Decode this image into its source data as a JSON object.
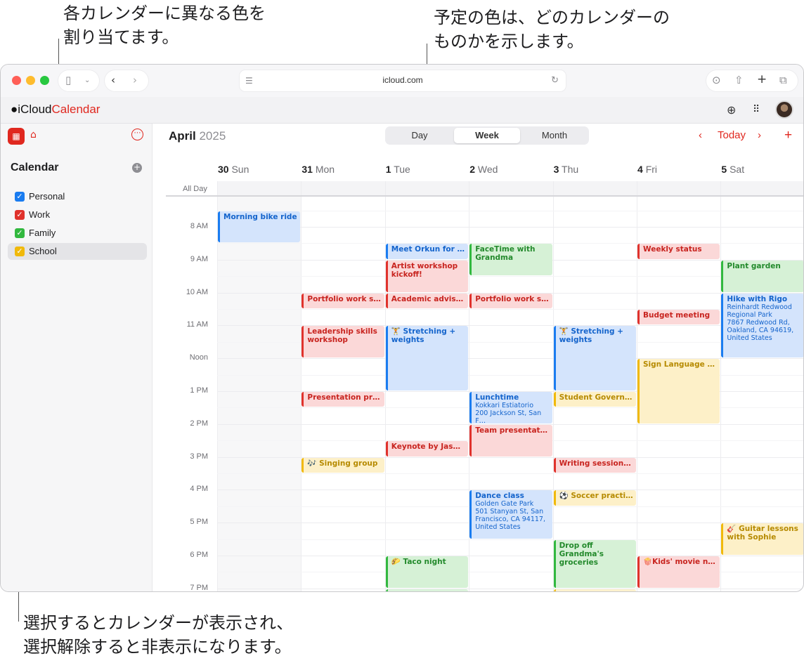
{
  "callouts": {
    "top_left": [
      "各カレンダーに異なる色を",
      "割り当てます。"
    ],
    "top_right": [
      "予定の色は、どのカレンダーの",
      "ものかを示します。"
    ],
    "bottom": [
      "選択するとカレンダーが表示され、",
      "選択解除すると非表示になります。"
    ]
  },
  "browser": {
    "url": "icloud.com",
    "traffic_lights": [
      "#ff5f57",
      "#febc2e",
      "#28c840"
    ]
  },
  "app": {
    "brand_prefix": "iCloud",
    "brand_name": "Calendar",
    "accent_color": "#e0281f"
  },
  "sidebar": {
    "section_title": "Calendar",
    "calendars": [
      {
        "label": "Personal",
        "color": "#1a7cf0",
        "checked": true,
        "selected": false
      },
      {
        "label": "Work",
        "color": "#e0322c",
        "checked": true,
        "selected": false
      },
      {
        "label": "Family",
        "color": "#32b83f",
        "checked": true,
        "selected": false
      },
      {
        "label": "School",
        "color": "#f0b90b",
        "checked": true,
        "selected": true
      }
    ]
  },
  "header": {
    "month": "April",
    "year": "2025",
    "views": [
      "Day",
      "Week",
      "Month"
    ],
    "active_view": "Week",
    "today_label": "Today"
  },
  "days": [
    {
      "num": "30",
      "name": "Sun"
    },
    {
      "num": "31",
      "name": "Mon"
    },
    {
      "num": "1",
      "name": "Tue"
    },
    {
      "num": "2",
      "name": "Wed"
    },
    {
      "num": "3",
      "name": "Thu"
    },
    {
      "num": "4",
      "name": "Fri"
    },
    {
      "num": "5",
      "name": "Sat"
    }
  ],
  "all_day_label": "All Day",
  "times": [
    "8 AM",
    "9 AM",
    "10 AM",
    "11 AM",
    "Noon",
    "1 PM",
    "2 PM",
    "3 PM",
    "4 PM",
    "5 PM",
    "6 PM",
    "7 PM"
  ],
  "events": [
    {
      "day": 0,
      "start": 7.5,
      "end": 8.5,
      "color": "blue",
      "title": "Morning bike ride",
      "trunc": false
    },
    {
      "day": 2,
      "start": 8.5,
      "end": 9.0,
      "color": "blue",
      "title": "Meet Orkun for coffee",
      "trunc": true
    },
    {
      "day": 2,
      "start": 9.0,
      "end": 10.0,
      "color": "red",
      "title": "Artist workshop kickoff!",
      "trunc": false
    },
    {
      "day": 2,
      "start": 10.0,
      "end": 10.5,
      "color": "red",
      "title": "Academic advising",
      "trunc": true
    },
    {
      "day": 2,
      "start": 11.0,
      "end": 13.0,
      "color": "blue",
      "title": "🏋 Stretching + weights",
      "trunc": false
    },
    {
      "day": 2,
      "start": 14.5,
      "end": 15.0,
      "color": "red",
      "title": "Keynote by Jasmine",
      "trunc": true
    },
    {
      "day": 2,
      "start": 18.0,
      "end": 19.0,
      "color": "green",
      "title": "🌮 Taco night",
      "trunc": true
    },
    {
      "day": 3,
      "start": 8.5,
      "end": 9.5,
      "color": "green",
      "title": "FaceTime with Grandma",
      "trunc": false
    },
    {
      "day": 3,
      "start": 10.0,
      "end": 10.5,
      "color": "red",
      "title": "Portfolio work session",
      "trunc": true
    },
    {
      "day": 3,
      "start": 13.0,
      "end": 14.0,
      "color": "blue",
      "title": "Lunchtime",
      "trunc": true,
      "sub": [
        "Kokkari Estiatorio",
        "200 Jackson St, San F…"
      ]
    },
    {
      "day": 3,
      "start": 14.0,
      "end": 15.0,
      "color": "red",
      "title": "Team presentation",
      "trunc": true
    },
    {
      "day": 3,
      "start": 16.0,
      "end": 17.5,
      "color": "blue",
      "title": "Dance class",
      "trunc": true,
      "sub": [
        "Golden Gate Park",
        "501 Stanyan St, San Francisco, CA 94117, United States"
      ]
    },
    {
      "day": 1,
      "start": 10.0,
      "end": 10.5,
      "color": "red",
      "title": "Portfolio work session",
      "trunc": true
    },
    {
      "day": 1,
      "start": 11.0,
      "end": 12.0,
      "color": "red",
      "title": "Leadership skills workshop",
      "trunc": false
    },
    {
      "day": 1,
      "start": 13.0,
      "end": 13.5,
      "color": "red",
      "title": "Presentation prep",
      "trunc": true
    },
    {
      "day": 1,
      "start": 15.0,
      "end": 15.5,
      "color": "yellow",
      "title": "🎶 Singing group",
      "trunc": true
    },
    {
      "day": 4,
      "start": 11.0,
      "end": 13.0,
      "color": "blue",
      "title": "🏋 Stretching + weights",
      "trunc": false
    },
    {
      "day": 4,
      "start": 13.0,
      "end": 13.5,
      "color": "yellow",
      "title": "Student Government",
      "trunc": true
    },
    {
      "day": 4,
      "start": 15.0,
      "end": 15.5,
      "color": "red",
      "title": "Writing session with",
      "trunc": true
    },
    {
      "day": 4,
      "start": 16.0,
      "end": 16.5,
      "color": "yellow",
      "title": "⚽ Soccer practice",
      "trunc": true
    },
    {
      "day": 4,
      "start": 17.5,
      "end": 19.0,
      "color": "green",
      "title": "Drop off Grandma's groceries",
      "trunc": false
    },
    {
      "day": 5,
      "start": 8.5,
      "end": 9.0,
      "color": "red",
      "title": "Weekly status",
      "trunc": true
    },
    {
      "day": 5,
      "start": 10.5,
      "end": 11.0,
      "color": "red",
      "title": "Budget meeting",
      "trunc": true
    },
    {
      "day": 5,
      "start": 12.0,
      "end": 14.0,
      "color": "yellow",
      "title": "Sign Language Club",
      "trunc": true
    },
    {
      "day": 5,
      "start": 18.0,
      "end": 19.0,
      "color": "red",
      "title": "🍿Kids' movie night",
      "trunc": true
    },
    {
      "day": 6,
      "start": 9.0,
      "end": 10.0,
      "color": "green",
      "title": "Plant garden",
      "trunc": true
    },
    {
      "day": 6,
      "start": 10.0,
      "end": 12.0,
      "color": "blue",
      "title": "Hike with Rigo",
      "trunc": true,
      "sub": [
        "Reinhardt Redwood Regional Park",
        "7867 Redwood Rd, Oakland, CA 94619, United States"
      ]
    },
    {
      "day": 6,
      "start": 17.0,
      "end": 18.0,
      "color": "yellow",
      "title": "🎸 Guitar lessons with Sophie",
      "trunc": false
    }
  ]
}
